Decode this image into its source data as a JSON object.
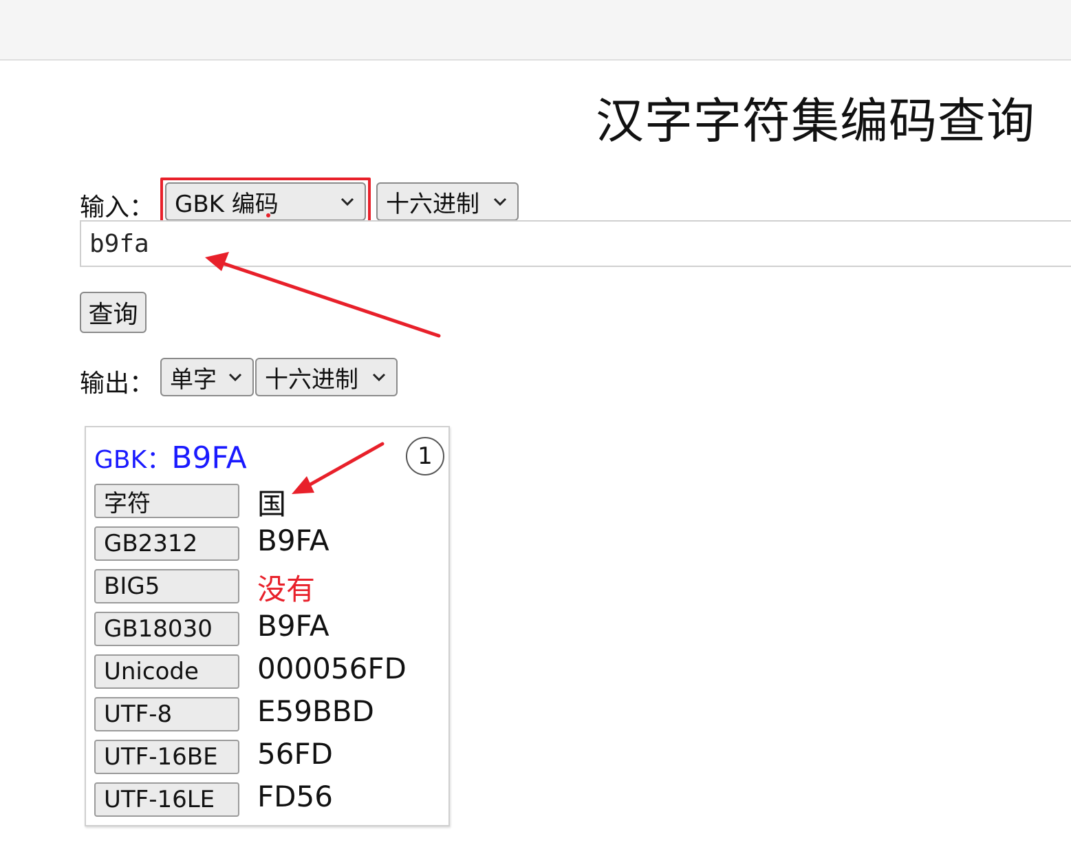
{
  "page_title": "汉字字符集编码查询",
  "input": {
    "label": "输入：",
    "encoding_select": "GBK 编码",
    "radix_select": "十六进制",
    "value": "b9fa",
    "query_button": "查询"
  },
  "output": {
    "label": "输出：",
    "mode_select": "单字",
    "radix_select": "十六进制"
  },
  "result": {
    "header_key": "GBK：",
    "header_value": "B9FA",
    "index": "1",
    "rows": [
      {
        "key": "字符",
        "value": "国"
      },
      {
        "key": "GB2312",
        "value": "B9FA"
      },
      {
        "key": "BIG5",
        "value": "没有"
      },
      {
        "key": "GB18030",
        "value": "B9FA"
      },
      {
        "key": "Unicode",
        "value": "000056FD"
      },
      {
        "key": "UTF-8",
        "value": "E59BBD"
      },
      {
        "key": "UTF-16BE",
        "value": "56FD"
      },
      {
        "key": "UTF-16LE",
        "value": "FD56"
      }
    ]
  },
  "colors": {
    "accent_blue": "#1a1aff",
    "annotation_red": "#e8202a",
    "missing_red": "#e8202a"
  }
}
